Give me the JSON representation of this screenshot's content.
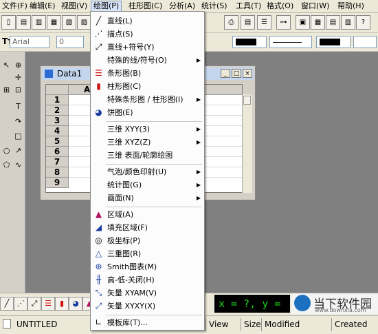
{
  "menubar": {
    "items": [
      "文件(F)",
      "编辑(E)",
      "视图(V)",
      "绘图(P)",
      "柱形图(C)",
      "分析(A)",
      "统计(S)",
      "工具(T)",
      "格式(O)",
      "窗口(W)",
      "帮助(H)"
    ]
  },
  "toolbar2": {
    "font_name": "Arial",
    "size_value": "0"
  },
  "child_window": {
    "title": "Data1",
    "column_header": "A",
    "row_numbers": [
      "1",
      "2",
      "3",
      "4",
      "5",
      "6",
      "7",
      "8",
      "9"
    ]
  },
  "plot_menu": {
    "items": [
      {
        "label": "直线(L)",
        "icon": "line-icon"
      },
      {
        "label": "描点(S)",
        "icon": "scatter-icon"
      },
      {
        "label": "直线+符号(Y)",
        "icon": "line-symbol-icon"
      },
      {
        "label": "特殊的线/符号(O)",
        "submenu": true
      },
      {
        "label": "条形图(B)",
        "icon": "bar-icon"
      },
      {
        "label": "柱形图(C)",
        "icon": "column-icon"
      },
      {
        "label": "特殊条形图 / 柱形图(I)",
        "submenu": true
      },
      {
        "label": "饼图(E)",
        "icon": "pie-icon"
      },
      {
        "label": "三维 XYY(3)",
        "submenu": true
      },
      {
        "label": "三维 XYZ(Z)",
        "submenu": true
      },
      {
        "label": "三维 表面/轮廓绘图"
      },
      {
        "label": "气泡/颜色印射(U)",
        "submenu": true
      },
      {
        "label": "统计图(G)",
        "submenu": true
      },
      {
        "label": "画面(N)",
        "submenu": true
      },
      {
        "label": "区域(A)",
        "icon": "area-icon"
      },
      {
        "label": "填充区域(F)",
        "icon": "fill-area-icon"
      },
      {
        "label": "极坐标(P)",
        "icon": "polar-icon"
      },
      {
        "label": "三重图(R)",
        "icon": "ternary-icon"
      },
      {
        "label": "Smith图表(M)",
        "icon": "smith-icon"
      },
      {
        "label": "高-低-关闭(H)",
        "icon": "hilo-icon"
      },
      {
        "label": "矢量 XYAM(V)",
        "icon": "vector-xyam-icon"
      },
      {
        "label": "矢量 XYXY(X)",
        "icon": "vector-xyxy-icon"
      },
      {
        "label": "模板库(T)...",
        "icon": "template-icon"
      }
    ]
  },
  "coord_readout": "x = ?, y = ?",
  "watermark": {
    "title": "当下软件园",
    "url": "www.downxia.com"
  },
  "statusbar": {
    "doc_name": "UNTITLED",
    "view": "View",
    "size": "Size",
    "modified": "Modified",
    "created": "Created"
  },
  "colors": {
    "menu_active": "#d8e4f8",
    "coord_bg": "#000000",
    "coord_text": "#17d517",
    "bar_red": "#d01010",
    "icon_blue": "#1a3fa0"
  }
}
